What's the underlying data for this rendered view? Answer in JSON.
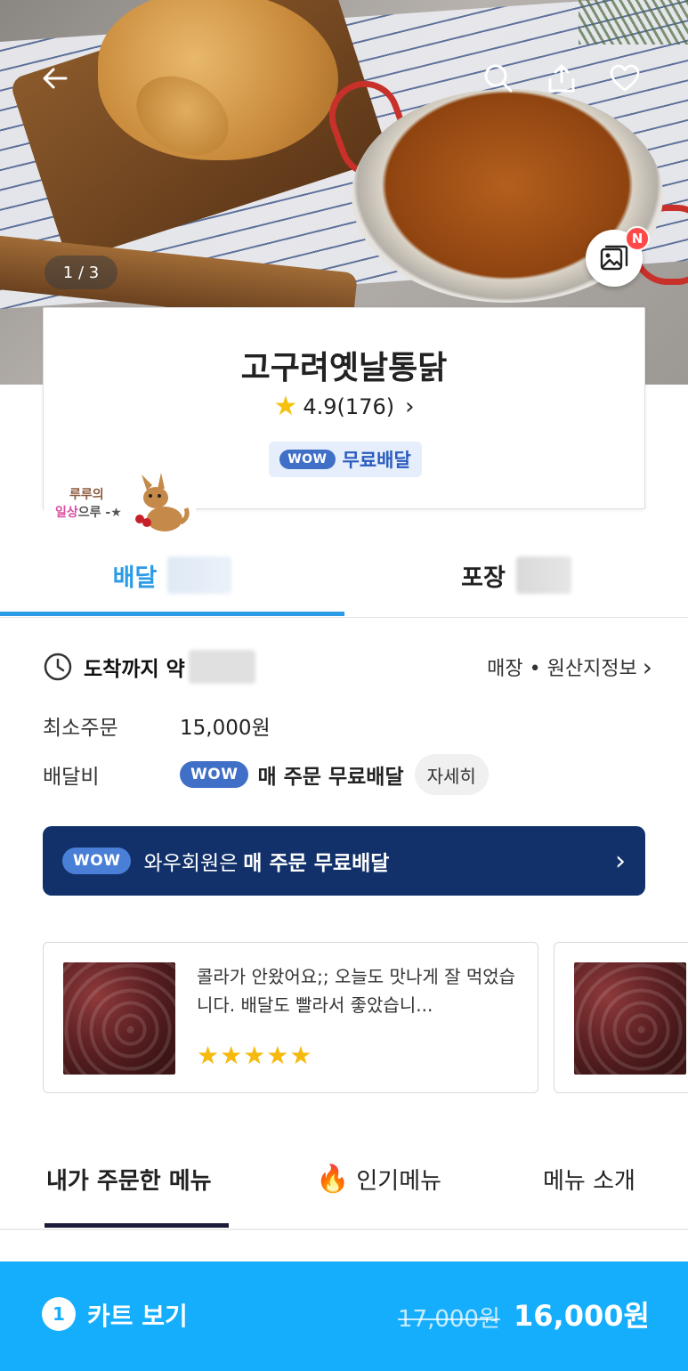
{
  "hero": {
    "image_counter": "1 / 3",
    "new_badge": "N",
    "icons": [
      "back-arrow-icon",
      "search-icon",
      "share-icon",
      "heart-icon",
      "gallery-icon"
    ]
  },
  "store": {
    "name": "고구려옛날통닭",
    "rating": "4.9(176)",
    "wow_pill": "WOW",
    "free_delivery": "무료배달"
  },
  "sticker": {
    "line1": "루루의",
    "line2a": "일상",
    "line2b": "으루 -★"
  },
  "tabs": {
    "delivery": "배달",
    "pickup": "포장"
  },
  "details": {
    "eta_label": "도착까지 약",
    "store_info_link": "매장 • 원산지정보",
    "min_order_label": "최소주문",
    "min_order_value": "15,000원",
    "delivery_fee_label": "배달비",
    "wow_pill": "WOW",
    "delivery_fee_value": "매 주문 무료배달",
    "detail_button": "자세히"
  },
  "wow_banner": {
    "pill": "WOW",
    "text_prefix": "와우회원은",
    "text_bold": "매 주문 무료배달"
  },
  "reviews": [
    {
      "text": "콜라가 안왔어요;; 오늘도 맛나게 잘 먹었습니다.  배달도 빨라서 좋았습니...",
      "stars": "★★★★★",
      "rating": 5
    }
  ],
  "menu_tabs": {
    "ordered": "내가 주문한 메뉴",
    "popular": "인기메뉴",
    "intro": "메뉴 소개"
  },
  "cart": {
    "count": "1",
    "label": "카트 보기",
    "original_price": "17,000원",
    "final_price": "16,000원"
  },
  "colors": {
    "accent_blue": "#2c9be6",
    "cart_blue": "#15aefc",
    "wow_navy": "#12316a",
    "star_yellow": "#f6c10e"
  }
}
